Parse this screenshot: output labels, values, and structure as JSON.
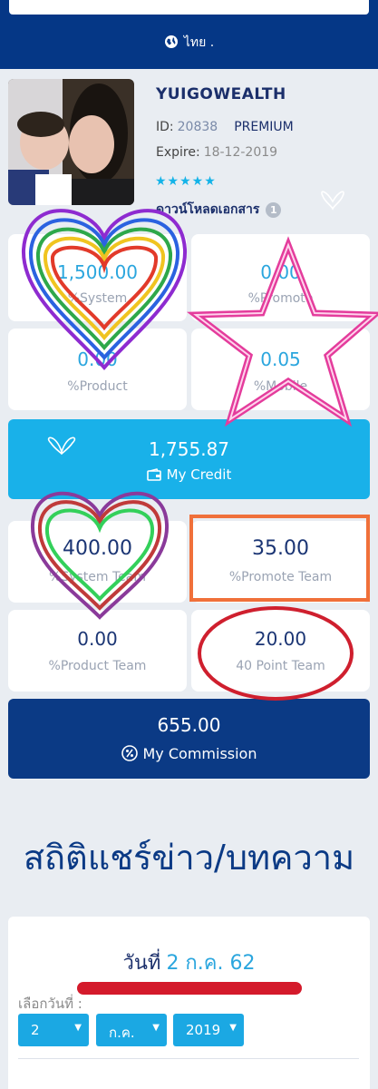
{
  "header": {
    "language": "ไทย ."
  },
  "profile": {
    "username": "YUIGOWEALTH",
    "id_label": "ID:",
    "id_value": "20838",
    "tier": "PREMIUM",
    "expire_label": "Expire:",
    "expire_value": "18-12-2019",
    "stars": "★★★★★",
    "download_label": "ดาวน์โหลดเอกสาร",
    "download_count": "1"
  },
  "stats": [
    {
      "value": "1,500.00",
      "label": "%System"
    },
    {
      "value": "0.00",
      "label": "%Promote"
    },
    {
      "value": "0.00",
      "label": "%Product"
    },
    {
      "value": "0.05",
      "label": "%Mobile"
    }
  ],
  "credit": {
    "value": "1,755.87",
    "label": "My Credit"
  },
  "team_stats": [
    {
      "value": "400.00",
      "label": "%System Team"
    },
    {
      "value": "35.00",
      "label": "%Promote Team"
    },
    {
      "value": "0.00",
      "label": "%Product Team"
    },
    {
      "value": "20.00",
      "label": "40 Point Team"
    }
  ],
  "commission": {
    "value": "655.00",
    "label": "My Commission"
  },
  "share_stats": {
    "title": "สถิติแชร์ข่าว/บทความ",
    "date_label": "วันที่",
    "date_value": "2 ก.ค. 62",
    "select_label": "เลือกวันที่ :",
    "day": "2",
    "month": "ก.ค.",
    "year": "2019"
  },
  "colors": {
    "navy": "#053786",
    "cyan": "#19b1e9",
    "value_blue": "#2ba6de",
    "value_navy": "#1b3574"
  }
}
